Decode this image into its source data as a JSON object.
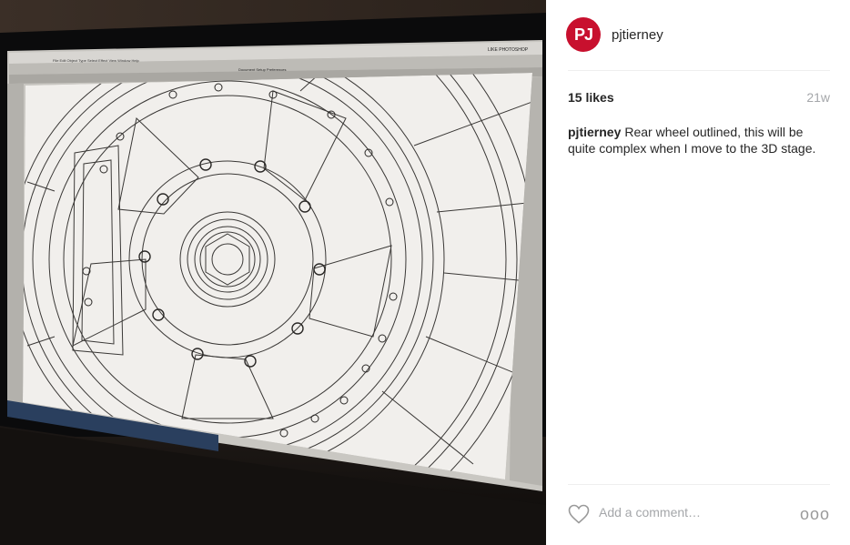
{
  "photo": {
    "software_title": "LIKE PHOTOSHOP",
    "menu_items": [
      "Ai",
      "File",
      "Edit",
      "Object",
      "Type",
      "Select",
      "Effect",
      "View",
      "Window",
      "Help"
    ],
    "control_bar_items": [
      "No Selection",
      "Stroke",
      "1 pt",
      "Uniform",
      "3 pt. Round",
      "Style",
      "Opacity",
      "100",
      "Document Setup",
      "Preferences"
    ],
    "doc_tab": "Brake CAD.ai @ 100% (RGB/Preview)"
  },
  "post": {
    "avatar_initials": "PJ",
    "username": "pjtierney",
    "likes": "15 likes",
    "age": "21w",
    "caption_user": "pjtierney",
    "caption_text": "Rear wheel outlined, this will be quite complex when I move to the 3D stage.",
    "comment_placeholder": "Add a comment…",
    "more_icon_text": "ooo"
  },
  "icons": [
    "heart-icon",
    "more-options-icon"
  ]
}
